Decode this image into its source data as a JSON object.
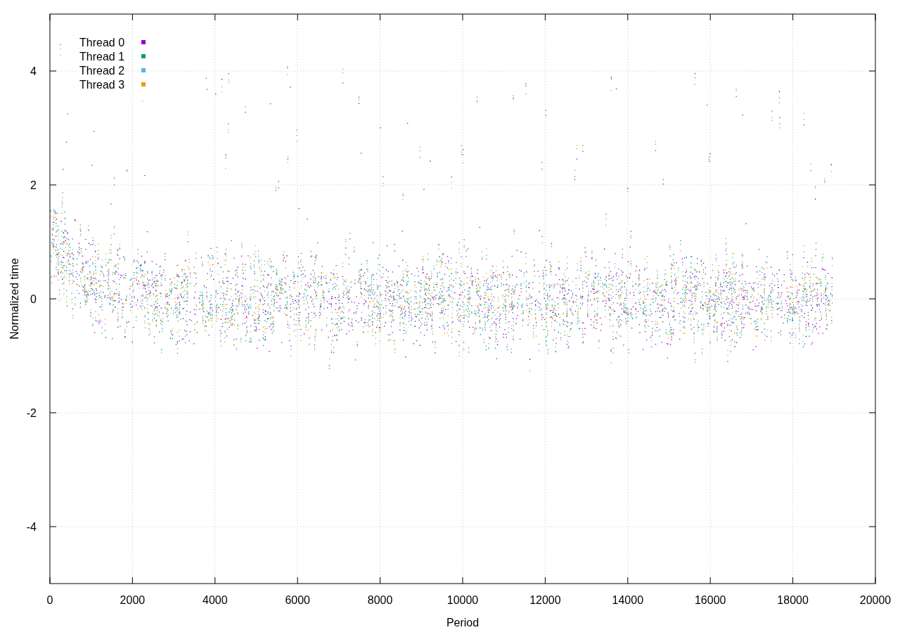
{
  "plot": {
    "xlabel": "Period",
    "ylabel": "Normalized time",
    "xticks": [
      "0",
      "2000",
      "4000",
      "6000",
      "8000",
      "10000",
      "12000",
      "14000",
      "16000",
      "18000",
      "20000"
    ],
    "yticks": [
      "4",
      "2",
      "0",
      "-2",
      "-4"
    ],
    "legend": [
      {
        "label": "Thread 0",
        "color": "#9400d3"
      },
      {
        "label": "Thread 1",
        "color": "#009e73"
      },
      {
        "label": "Thread 2",
        "color": "#56b4e9"
      },
      {
        "label": "Thread 3",
        "color": "#e69f00"
      }
    ]
  }
}
